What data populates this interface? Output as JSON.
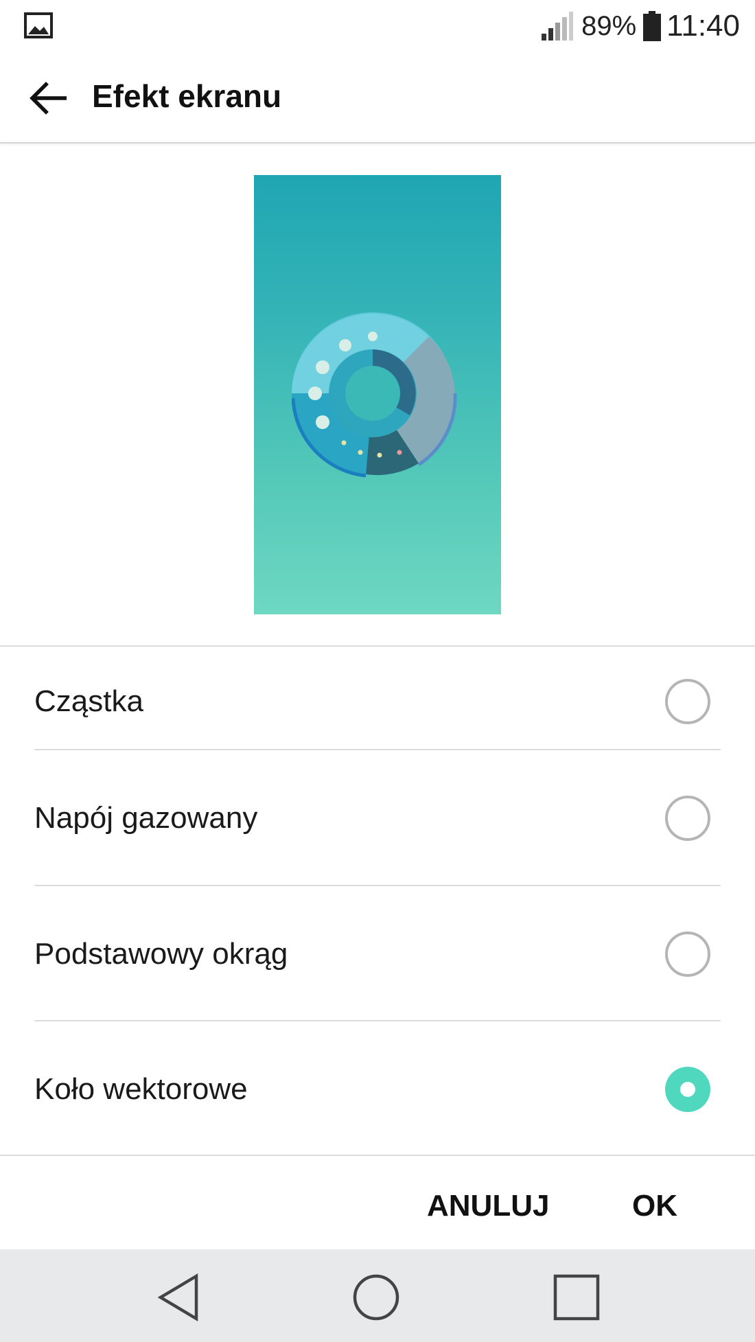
{
  "status_bar": {
    "battery_percent": "89%",
    "time": "11:40",
    "icons": [
      "gallery-icon",
      "signal-icon",
      "battery-icon"
    ]
  },
  "app_bar": {
    "title": "Efekt ekranu",
    "back_icon": "back-arrow-icon"
  },
  "options": [
    {
      "label": "Cząstka",
      "selected": false
    },
    {
      "label": "Napój gazowany",
      "selected": false
    },
    {
      "label": "Podstawowy okrąg",
      "selected": false
    },
    {
      "label": "Koło wektorowe",
      "selected": true
    }
  ],
  "buttons": {
    "cancel": "ANULUJ",
    "ok": "OK"
  },
  "nav_bar": {
    "icons": [
      "back-triangle-icon",
      "home-circle-icon",
      "recents-square-icon"
    ]
  },
  "colors": {
    "accent": "#4fd8bd",
    "preview_top": "#1fa6b3",
    "preview_bottom": "#6ed8c2",
    "nav_background": "#e8e9eb"
  }
}
